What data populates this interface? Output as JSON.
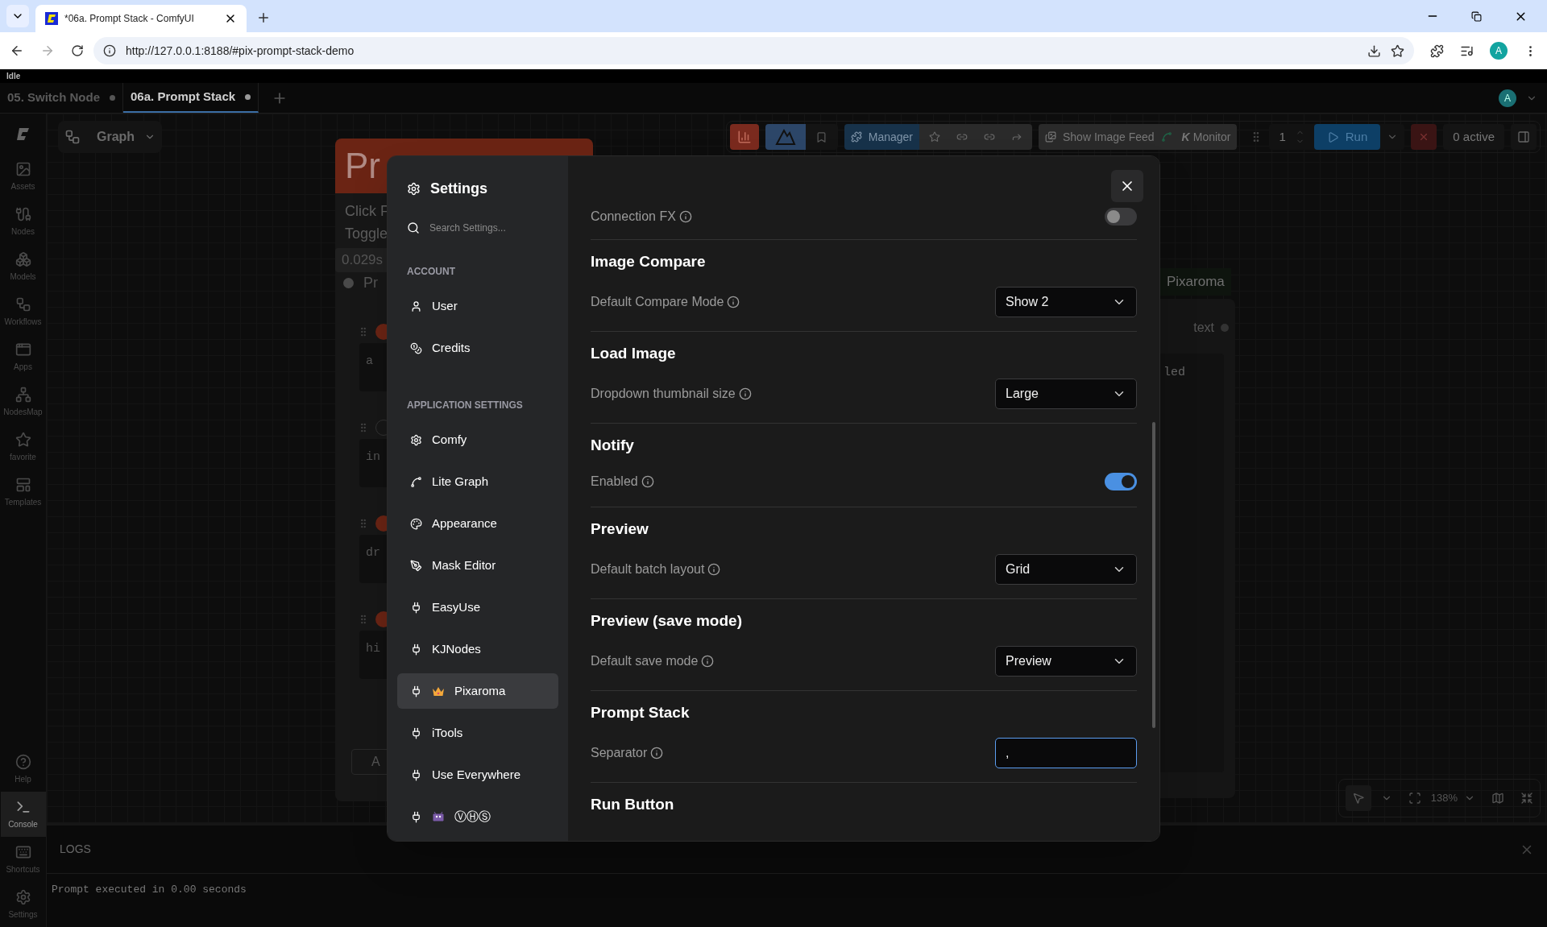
{
  "browser": {
    "tab_title": "*06a. Prompt Stack - ComfyUI",
    "url": "http://127.0.0.1:8188/#pix-prompt-stack-demo",
    "profile": "A"
  },
  "status": "Idle",
  "workflow_tabs": [
    {
      "label": "05. Switch Node",
      "selected": false
    },
    {
      "label": "06a. Prompt Stack",
      "selected": true
    }
  ],
  "user_avatar": "A",
  "sidebar": {
    "top": [
      {
        "label": "Assets",
        "selected": false
      },
      {
        "label": "Nodes",
        "selected": false
      },
      {
        "label": "Models",
        "selected": false
      },
      {
        "label": "Workflows",
        "selected": false
      },
      {
        "label": "Apps",
        "selected": false
      },
      {
        "label": "NodesMap",
        "selected": false
      },
      {
        "label": "favorite",
        "selected": false
      },
      {
        "label": "Templates",
        "selected": false
      }
    ],
    "bottom": [
      {
        "label": "Help",
        "selected": false
      },
      {
        "label": "Console",
        "selected": true
      },
      {
        "label": "Shortcuts",
        "selected": false
      },
      {
        "label": "Settings",
        "selected": false
      }
    ]
  },
  "graph_menu": "Graph",
  "toolbar": {
    "manager": "Manager",
    "image_feed": "Show Image Feed",
    "monitor_mark": "K",
    "monitor": "Monitor",
    "queue_count": "1",
    "run": "Run",
    "active": "0 active"
  },
  "canvas": {
    "node": {
      "title": "Pr",
      "lines": [
        "Click F",
        "Toggle"
      ],
      "time": "0.029s",
      "status": "Pr",
      "rows": [
        {
          "text": "a",
          "on": true
        },
        {
          "text": "in",
          "on": false
        },
        {
          "text": "dr",
          "on": true
        },
        {
          "text": "hi",
          "on": true
        }
      ],
      "button": "A"
    },
    "group_label": "Pixaroma",
    "output_label": "text",
    "text_fragment": "led",
    "zoom": "138%"
  },
  "settings": {
    "title": "Settings",
    "search_placeholder": "Search Settings...",
    "nav": [
      {
        "heading": "ACCOUNT",
        "items": [
          {
            "label": "User",
            "kind": "user",
            "selected": false
          },
          {
            "label": "Credits",
            "kind": "credits",
            "selected": false
          }
        ]
      },
      {
        "heading": "APPLICATION SETTINGS",
        "items": [
          {
            "label": "Comfy",
            "kind": "gear",
            "selected": false
          },
          {
            "label": "Lite Graph",
            "kind": "graph",
            "selected": false
          },
          {
            "label": "Appearance",
            "kind": "palette",
            "selected": false
          },
          {
            "label": "Mask Editor",
            "kind": "pen",
            "selected": false
          },
          {
            "label": "EasyUse",
            "kind": "plugin",
            "selected": false
          },
          {
            "label": "KJNodes",
            "kind": "plugin",
            "selected": false
          },
          {
            "label": "Pixaroma",
            "kind": "crowned",
            "selected": true
          },
          {
            "label": "iTools",
            "kind": "plugin",
            "selected": false
          },
          {
            "label": "Use Everywhere",
            "kind": "plugin",
            "selected": false
          },
          {
            "label": "ⓋⒽⓈ",
            "kind": "creature",
            "selected": false
          }
        ]
      }
    ],
    "sections": [
      {
        "rows": [
          {
            "label": "Connection FX",
            "kind": "toggle",
            "on": false
          }
        ]
      },
      {
        "title": "Image Compare",
        "rows": [
          {
            "label": "Default Compare Mode",
            "kind": "select",
            "value": "Show 2"
          }
        ]
      },
      {
        "title": "Load Image",
        "rows": [
          {
            "label": "Dropdown thumbnail size",
            "kind": "select",
            "value": "Large"
          }
        ]
      },
      {
        "title": "Notify",
        "rows": [
          {
            "label": "Enabled",
            "kind": "toggle",
            "on": true
          }
        ]
      },
      {
        "title": "Preview",
        "rows": [
          {
            "label": "Default batch layout",
            "kind": "select",
            "value": "Grid"
          }
        ]
      },
      {
        "title": "Preview (save mode)",
        "rows": [
          {
            "label": "Default save mode",
            "kind": "select",
            "value": "Preview"
          }
        ]
      },
      {
        "title": "Prompt Stack",
        "rows": [
          {
            "label": "Separator",
            "kind": "input",
            "value": ","
          }
        ]
      },
      {
        "title": "Run Button"
      }
    ]
  },
  "logs": {
    "title": "LOGS",
    "lines": [
      "Prompt executed in 0.00 seconds"
    ]
  }
}
